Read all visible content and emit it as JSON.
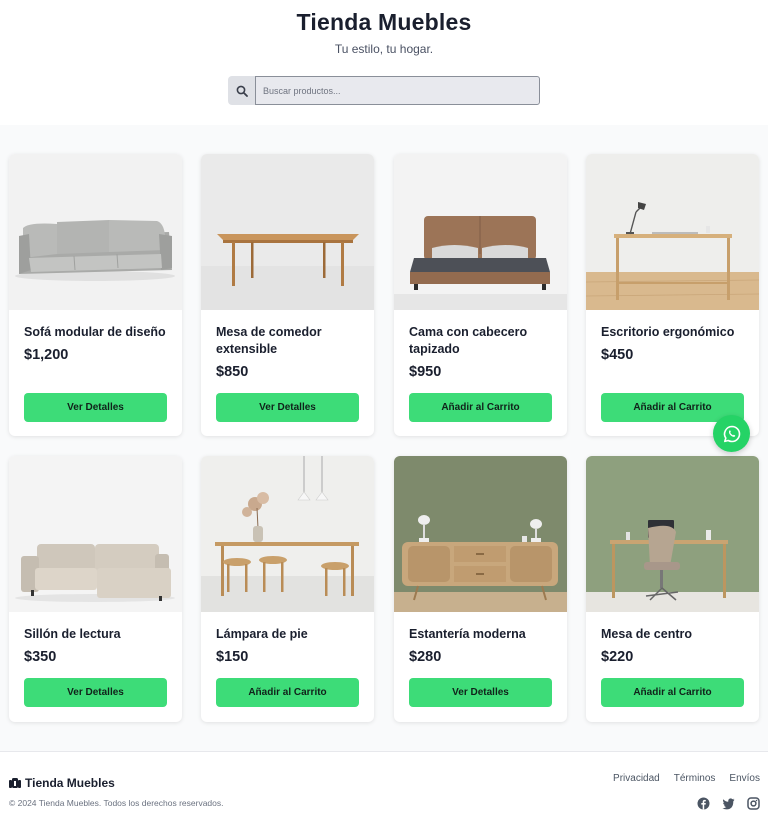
{
  "header": {
    "title": "Tienda Muebles",
    "tagline": "Tu estilo, tu hogar."
  },
  "search": {
    "placeholder": "Buscar productos...",
    "icon": "search-icon"
  },
  "products": [
    {
      "name": "Sofá modular de diseño",
      "price": "$1,200",
      "button": "Ver Detalles",
      "image": "grey-sofa"
    },
    {
      "name": "Mesa de comedor extensible",
      "price": "$850",
      "button": "Ver Detalles",
      "image": "wooden-dining-table"
    },
    {
      "name": "Cama con cabecero tapizado",
      "price": "$950",
      "button": "Añadir al Carrito",
      "image": "upholstered-bed"
    },
    {
      "name": "Escritorio ergonómico",
      "price": "$450",
      "button": "Añadir al Carrito",
      "image": "wooden-desk-with-lamp"
    },
    {
      "name": "Sillón de lectura",
      "price": "$350",
      "button": "Ver Detalles",
      "image": "sectional-sofa"
    },
    {
      "name": "Lámpara de pie",
      "price": "$150",
      "button": "Añadir al Carrito",
      "image": "dining-set-with-pendant-lamps"
    },
    {
      "name": "Estantería moderna",
      "price": "$280",
      "button": "Ver Detalles",
      "image": "rattan-sideboard"
    },
    {
      "name": "Mesa de centro",
      "price": "$220",
      "button": "Añadir al Carrito",
      "image": "desk-with-office-chair"
    }
  ],
  "whatsapp": {
    "icon": "whatsapp-icon"
  },
  "footer": {
    "brand": "Tienda Muebles",
    "copyright": "© 2024 Tienda Muebles. Todos los derechos reservados.",
    "links": [
      "Privacidad",
      "Términos",
      "Envíos"
    ],
    "social_icons": [
      "facebook-icon",
      "twitter-icon",
      "instagram-icon"
    ]
  },
  "colors": {
    "accent": "#3ddc78",
    "whatsapp": "#25d366",
    "text": "#1a1f2e",
    "section_bg": "#f9fafb"
  }
}
